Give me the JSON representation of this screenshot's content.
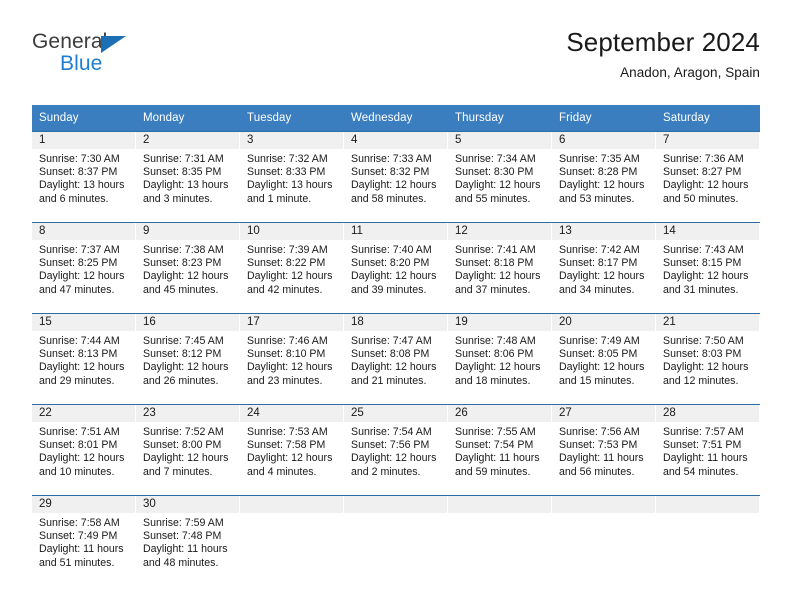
{
  "brand": {
    "name_top": "General",
    "name_bottom": "Blue",
    "accent_color": "#1c7fd4"
  },
  "header": {
    "title": "September 2024",
    "subtitle": "Anadon, Aragon, Spain"
  },
  "theme": {
    "header_blue": "#3a7ebf",
    "rule_blue": "#2d6da4",
    "daynum_band": "#f0f0f0"
  },
  "weekday_headers": [
    "Sunday",
    "Monday",
    "Tuesday",
    "Wednesday",
    "Thursday",
    "Friday",
    "Saturday"
  ],
  "labels": {
    "sunrise_prefix": "Sunrise:",
    "sunset_prefix": "Sunset:",
    "daylight_prefix": "Daylight:"
  },
  "weeks": [
    [
      {
        "day": "1",
        "sunrise": "Sunrise: 7:30 AM",
        "sunset": "Sunset: 8:37 PM",
        "daylight_line1": "Daylight: 13 hours",
        "daylight_line2": "and 6 minutes."
      },
      {
        "day": "2",
        "sunrise": "Sunrise: 7:31 AM",
        "sunset": "Sunset: 8:35 PM",
        "daylight_line1": "Daylight: 13 hours",
        "daylight_line2": "and 3 minutes."
      },
      {
        "day": "3",
        "sunrise": "Sunrise: 7:32 AM",
        "sunset": "Sunset: 8:33 PM",
        "daylight_line1": "Daylight: 13 hours",
        "daylight_line2": "and 1 minute."
      },
      {
        "day": "4",
        "sunrise": "Sunrise: 7:33 AM",
        "sunset": "Sunset: 8:32 PM",
        "daylight_line1": "Daylight: 12 hours",
        "daylight_line2": "and 58 minutes."
      },
      {
        "day": "5",
        "sunrise": "Sunrise: 7:34 AM",
        "sunset": "Sunset: 8:30 PM",
        "daylight_line1": "Daylight: 12 hours",
        "daylight_line2": "and 55 minutes."
      },
      {
        "day": "6",
        "sunrise": "Sunrise: 7:35 AM",
        "sunset": "Sunset: 8:28 PM",
        "daylight_line1": "Daylight: 12 hours",
        "daylight_line2": "and 53 minutes."
      },
      {
        "day": "7",
        "sunrise": "Sunrise: 7:36 AM",
        "sunset": "Sunset: 8:27 PM",
        "daylight_line1": "Daylight: 12 hours",
        "daylight_line2": "and 50 minutes."
      }
    ],
    [
      {
        "day": "8",
        "sunrise": "Sunrise: 7:37 AM",
        "sunset": "Sunset: 8:25 PM",
        "daylight_line1": "Daylight: 12 hours",
        "daylight_line2": "and 47 minutes."
      },
      {
        "day": "9",
        "sunrise": "Sunrise: 7:38 AM",
        "sunset": "Sunset: 8:23 PM",
        "daylight_line1": "Daylight: 12 hours",
        "daylight_line2": "and 45 minutes."
      },
      {
        "day": "10",
        "sunrise": "Sunrise: 7:39 AM",
        "sunset": "Sunset: 8:22 PM",
        "daylight_line1": "Daylight: 12 hours",
        "daylight_line2": "and 42 minutes."
      },
      {
        "day": "11",
        "sunrise": "Sunrise: 7:40 AM",
        "sunset": "Sunset: 8:20 PM",
        "daylight_line1": "Daylight: 12 hours",
        "daylight_line2": "and 39 minutes."
      },
      {
        "day": "12",
        "sunrise": "Sunrise: 7:41 AM",
        "sunset": "Sunset: 8:18 PM",
        "daylight_line1": "Daylight: 12 hours",
        "daylight_line2": "and 37 minutes."
      },
      {
        "day": "13",
        "sunrise": "Sunrise: 7:42 AM",
        "sunset": "Sunset: 8:17 PM",
        "daylight_line1": "Daylight: 12 hours",
        "daylight_line2": "and 34 minutes."
      },
      {
        "day": "14",
        "sunrise": "Sunrise: 7:43 AM",
        "sunset": "Sunset: 8:15 PM",
        "daylight_line1": "Daylight: 12 hours",
        "daylight_line2": "and 31 minutes."
      }
    ],
    [
      {
        "day": "15",
        "sunrise": "Sunrise: 7:44 AM",
        "sunset": "Sunset: 8:13 PM",
        "daylight_line1": "Daylight: 12 hours",
        "daylight_line2": "and 29 minutes."
      },
      {
        "day": "16",
        "sunrise": "Sunrise: 7:45 AM",
        "sunset": "Sunset: 8:12 PM",
        "daylight_line1": "Daylight: 12 hours",
        "daylight_line2": "and 26 minutes."
      },
      {
        "day": "17",
        "sunrise": "Sunrise: 7:46 AM",
        "sunset": "Sunset: 8:10 PM",
        "daylight_line1": "Daylight: 12 hours",
        "daylight_line2": "and 23 minutes."
      },
      {
        "day": "18",
        "sunrise": "Sunrise: 7:47 AM",
        "sunset": "Sunset: 8:08 PM",
        "daylight_line1": "Daylight: 12 hours",
        "daylight_line2": "and 21 minutes."
      },
      {
        "day": "19",
        "sunrise": "Sunrise: 7:48 AM",
        "sunset": "Sunset: 8:06 PM",
        "daylight_line1": "Daylight: 12 hours",
        "daylight_line2": "and 18 minutes."
      },
      {
        "day": "20",
        "sunrise": "Sunrise: 7:49 AM",
        "sunset": "Sunset: 8:05 PM",
        "daylight_line1": "Daylight: 12 hours",
        "daylight_line2": "and 15 minutes."
      },
      {
        "day": "21",
        "sunrise": "Sunrise: 7:50 AM",
        "sunset": "Sunset: 8:03 PM",
        "daylight_line1": "Daylight: 12 hours",
        "daylight_line2": "and 12 minutes."
      }
    ],
    [
      {
        "day": "22",
        "sunrise": "Sunrise: 7:51 AM",
        "sunset": "Sunset: 8:01 PM",
        "daylight_line1": "Daylight: 12 hours",
        "daylight_line2": "and 10 minutes."
      },
      {
        "day": "23",
        "sunrise": "Sunrise: 7:52 AM",
        "sunset": "Sunset: 8:00 PM",
        "daylight_line1": "Daylight: 12 hours",
        "daylight_line2": "and 7 minutes."
      },
      {
        "day": "24",
        "sunrise": "Sunrise: 7:53 AM",
        "sunset": "Sunset: 7:58 PM",
        "daylight_line1": "Daylight: 12 hours",
        "daylight_line2": "and 4 minutes."
      },
      {
        "day": "25",
        "sunrise": "Sunrise: 7:54 AM",
        "sunset": "Sunset: 7:56 PM",
        "daylight_line1": "Daylight: 12 hours",
        "daylight_line2": "and 2 minutes."
      },
      {
        "day": "26",
        "sunrise": "Sunrise: 7:55 AM",
        "sunset": "Sunset: 7:54 PM",
        "daylight_line1": "Daylight: 11 hours",
        "daylight_line2": "and 59 minutes."
      },
      {
        "day": "27",
        "sunrise": "Sunrise: 7:56 AM",
        "sunset": "Sunset: 7:53 PM",
        "daylight_line1": "Daylight: 11 hours",
        "daylight_line2": "and 56 minutes."
      },
      {
        "day": "28",
        "sunrise": "Sunrise: 7:57 AM",
        "sunset": "Sunset: 7:51 PM",
        "daylight_line1": "Daylight: 11 hours",
        "daylight_line2": "and 54 minutes."
      }
    ],
    [
      {
        "day": "29",
        "sunrise": "Sunrise: 7:58 AM",
        "sunset": "Sunset: 7:49 PM",
        "daylight_line1": "Daylight: 11 hours",
        "daylight_line2": "and 51 minutes."
      },
      {
        "day": "30",
        "sunrise": "Sunrise: 7:59 AM",
        "sunset": "Sunset: 7:48 PM",
        "daylight_line1": "Daylight: 11 hours",
        "daylight_line2": "and 48 minutes."
      },
      {
        "day": "",
        "sunrise": "",
        "sunset": "",
        "daylight_line1": "",
        "daylight_line2": ""
      },
      {
        "day": "",
        "sunrise": "",
        "sunset": "",
        "daylight_line1": "",
        "daylight_line2": ""
      },
      {
        "day": "",
        "sunrise": "",
        "sunset": "",
        "daylight_line1": "",
        "daylight_line2": ""
      },
      {
        "day": "",
        "sunrise": "",
        "sunset": "",
        "daylight_line1": "",
        "daylight_line2": ""
      },
      {
        "day": "",
        "sunrise": "",
        "sunset": "",
        "daylight_line1": "",
        "daylight_line2": ""
      }
    ]
  ]
}
